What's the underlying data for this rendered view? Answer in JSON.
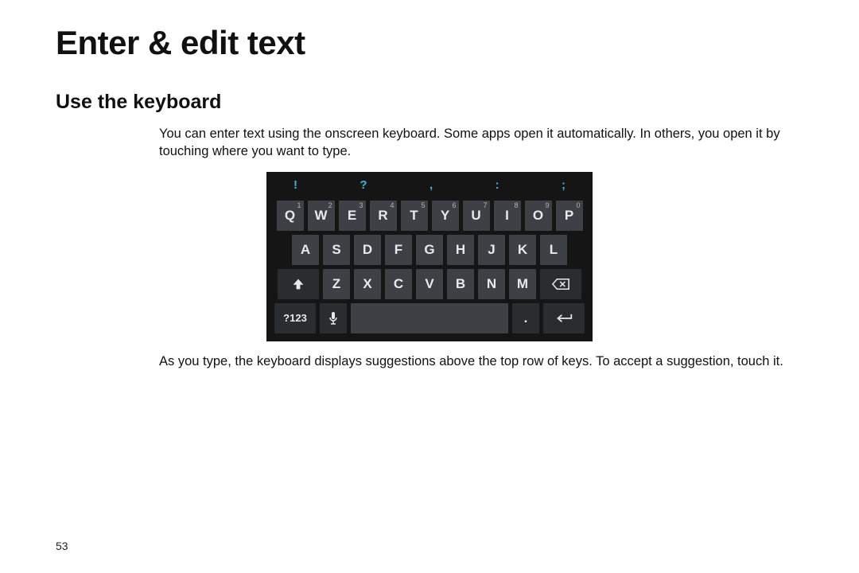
{
  "heading": "Enter & edit text",
  "subheading": "Use the keyboard",
  "para1": "You can enter text using the onscreen keyboard. Some apps open it automatically. In others, you open it by touching where you want to type.",
  "para2": "As you type, the keyboard displays suggestions above the top row of keys. To accept a suggestion, touch it.",
  "page_number": "53",
  "keyboard": {
    "suggestions": [
      "!",
      "?",
      ",",
      ":",
      ";"
    ],
    "row1": [
      {
        "l": "Q",
        "s": "1"
      },
      {
        "l": "W",
        "s": "2"
      },
      {
        "l": "E",
        "s": "3"
      },
      {
        "l": "R",
        "s": "4"
      },
      {
        "l": "T",
        "s": "5"
      },
      {
        "l": "Y",
        "s": "6"
      },
      {
        "l": "U",
        "s": "7"
      },
      {
        "l": "I",
        "s": "8"
      },
      {
        "l": "O",
        "s": "9"
      },
      {
        "l": "P",
        "s": "0"
      }
    ],
    "row2": [
      "A",
      "S",
      "D",
      "F",
      "G",
      "H",
      "J",
      "K",
      "L"
    ],
    "row3": [
      "Z",
      "X",
      "C",
      "V",
      "B",
      "N",
      "M"
    ],
    "row4": {
      "symbols": "?123",
      "period": "."
    }
  }
}
